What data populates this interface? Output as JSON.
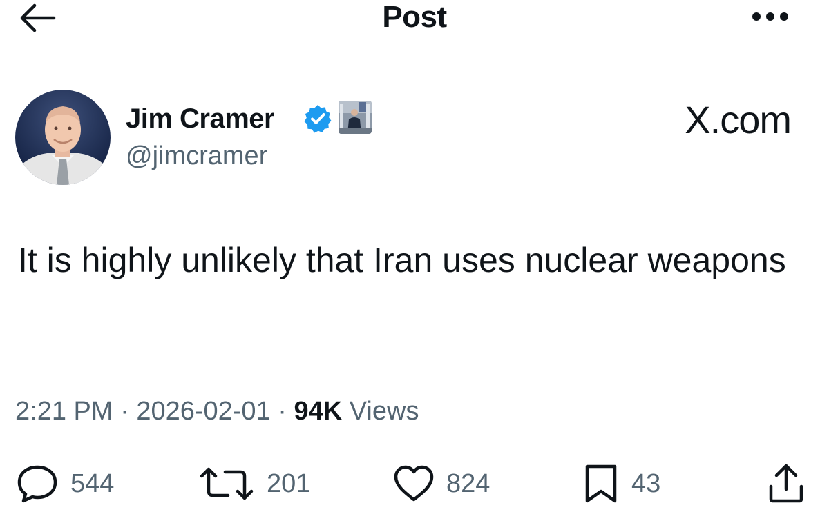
{
  "header": {
    "title": "Post",
    "back_icon": "arrow-left-icon",
    "more_icon": "more-horizontal-icon"
  },
  "author": {
    "name": "Jim Cramer",
    "handle": "@jimcramer",
    "verified": true,
    "verified_color": "#1d9bf0"
  },
  "watermark": "X.com",
  "post": {
    "text": "It is highly unlikely that Iran uses nuclear weapons",
    "time": "2:21 PM",
    "date": "2026-02-01",
    "separator": "·",
    "views_count": "94K",
    "views_label": "Views"
  },
  "actions": {
    "reply": {
      "icon": "reply-icon",
      "count": "544"
    },
    "repost": {
      "icon": "repost-icon",
      "count": "201"
    },
    "like": {
      "icon": "heart-icon",
      "count": "824"
    },
    "bookmark": {
      "icon": "bookmark-icon",
      "count": "43"
    },
    "share": {
      "icon": "share-icon"
    }
  },
  "colors": {
    "text_primary": "#0f1419",
    "text_secondary": "#536471",
    "accent": "#1d9bf0"
  }
}
